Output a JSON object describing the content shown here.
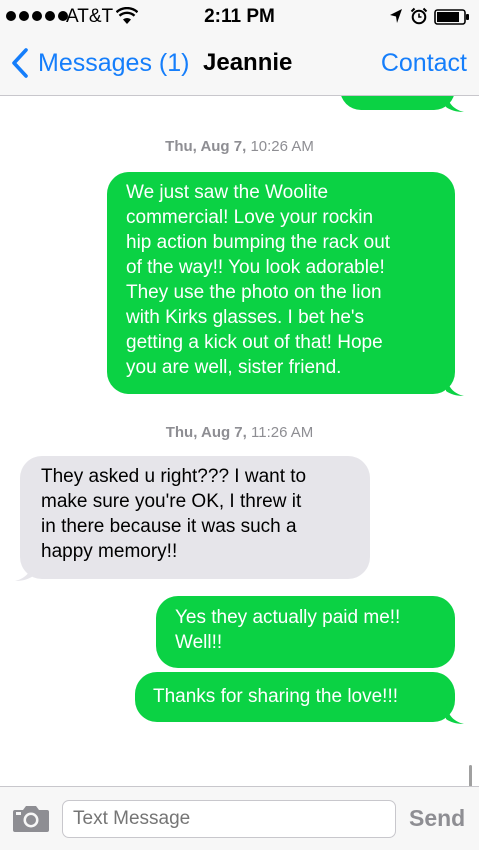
{
  "status_bar": {
    "carrier": "AT&T",
    "time": "2:11 PM",
    "signal_icon": "signal-dots-icon",
    "wifi_icon": "wifi-icon",
    "location_icon": "location-arrow-icon",
    "alarm_icon": "alarm-clock-icon",
    "battery_icon": "battery-icon"
  },
  "nav": {
    "back_label": "Messages (1)",
    "title": "Jeannie",
    "contact_label": "Contact"
  },
  "messages": [
    {
      "timestamp_day": "Thu, Aug 7,",
      "timestamp_time": " 10:26 AM",
      "direction": "out",
      "lines": [
        "We just saw the Woolite",
        "commercial! Love your rockin",
        "hip action bumping the rack out",
        "of the way!! You look adorable!",
        "They use the photo on the lion",
        "with Kirks glasses. I bet he's",
        "getting a kick out of that! Hope",
        "you are well, sister friend."
      ]
    },
    {
      "timestamp_day": "Thu, Aug 7,",
      "timestamp_time": " 11:26 AM",
      "direction": "in",
      "lines": [
        "They asked u right??? I want to",
        "make sure you're OK,  I threw it",
        "in there because it was such a",
        "happy memory!!"
      ]
    },
    {
      "direction": "out",
      "lines": [
        "Yes they actually paid me!!",
        "Well!!"
      ]
    },
    {
      "direction": "out",
      "lines": [
        "Thanks for sharing the love!!!"
      ]
    }
  ],
  "input": {
    "placeholder": "Text Message",
    "send_label": "Send",
    "camera_icon": "camera-icon"
  },
  "colors": {
    "outgoing_bubble": "#0bd244",
    "incoming_bubble": "#e6e5ea",
    "accent_blue": "#157efb",
    "timestamp_gray": "#8e8e93"
  }
}
